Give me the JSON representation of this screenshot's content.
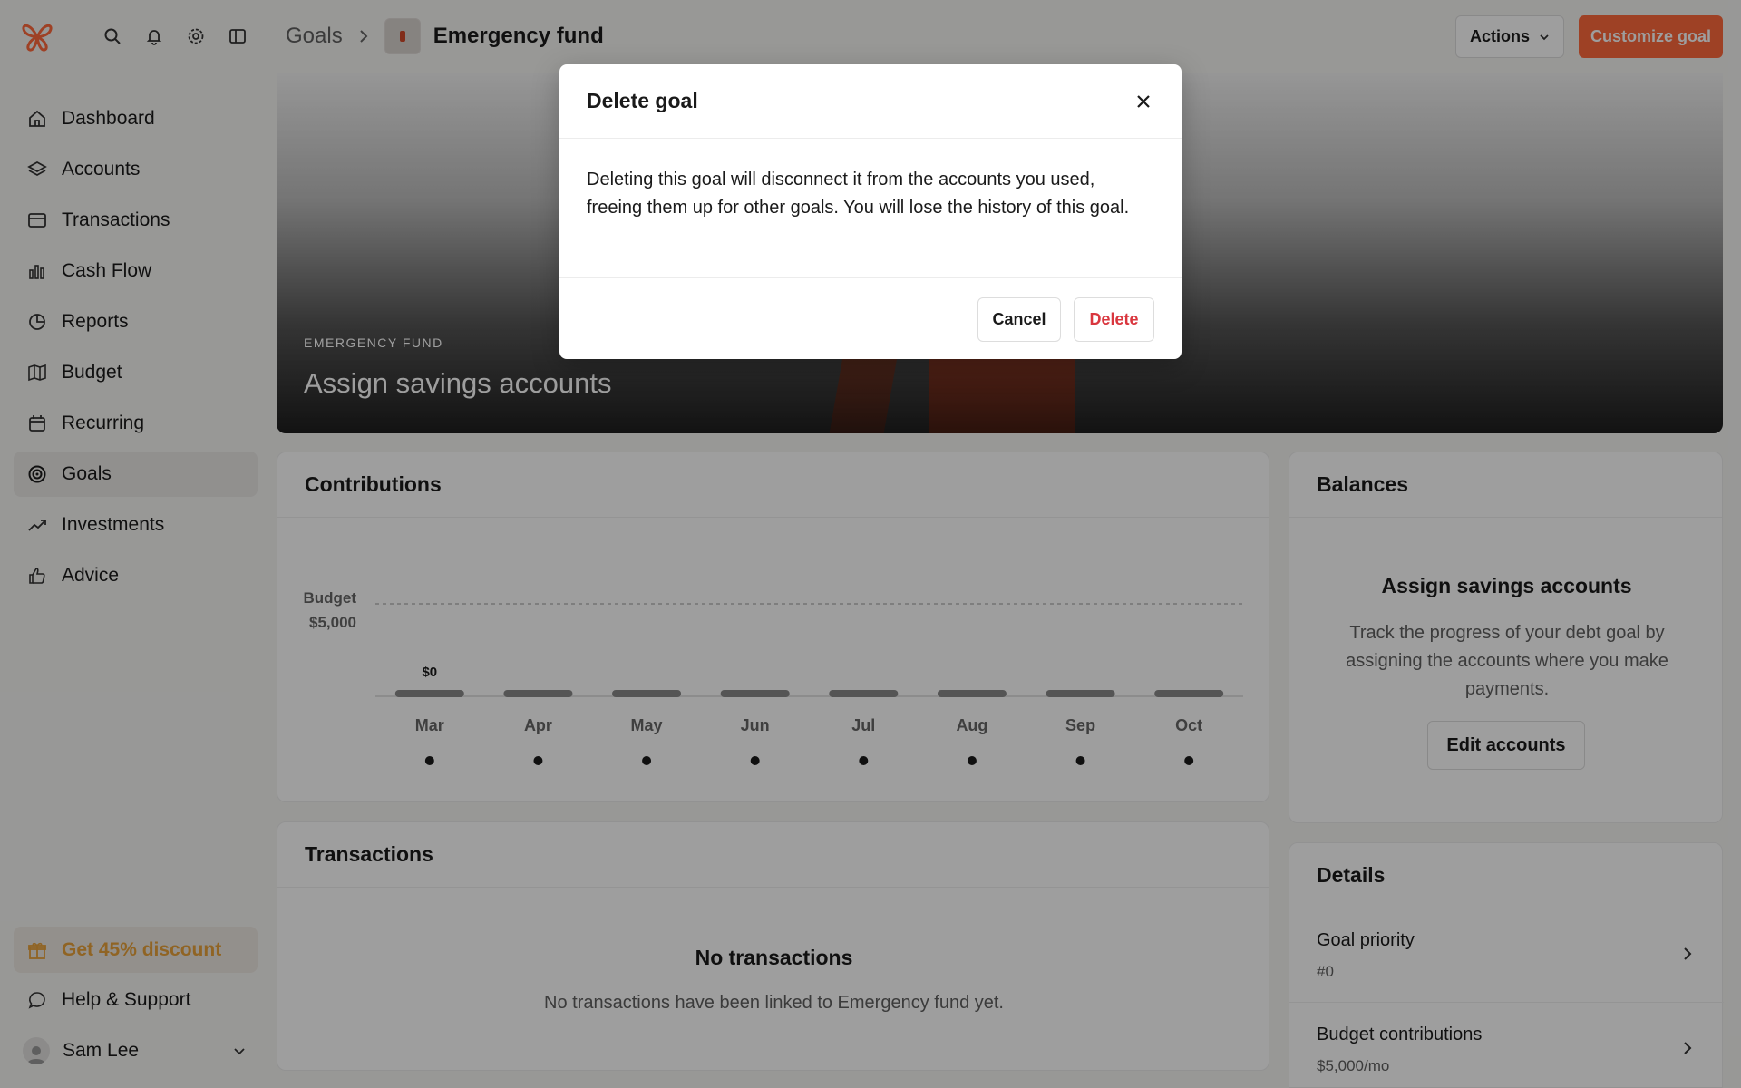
{
  "header": {
    "breadcrumb_root": "Goals",
    "breadcrumb_current": "Emergency fund",
    "actions_label": "Actions",
    "customize_label": "Customize goal"
  },
  "sidebar": {
    "items": [
      {
        "label": "Dashboard",
        "icon": "home-icon"
      },
      {
        "label": "Accounts",
        "icon": "layers-icon"
      },
      {
        "label": "Transactions",
        "icon": "card-icon"
      },
      {
        "label": "Cash Flow",
        "icon": "bar-chart-icon"
      },
      {
        "label": "Reports",
        "icon": "pie-chart-icon"
      },
      {
        "label": "Budget",
        "icon": "map-icon"
      },
      {
        "label": "Recurring",
        "icon": "calendar-icon"
      },
      {
        "label": "Goals",
        "icon": "target-icon"
      },
      {
        "label": "Investments",
        "icon": "trending-up-icon"
      },
      {
        "label": "Advice",
        "icon": "thumbs-up-icon"
      }
    ],
    "active": "Goals",
    "discount_label": "Get 45% discount",
    "help_label": "Help & Support",
    "user_name": "Sam Lee"
  },
  "hero": {
    "eyebrow": "EMERGENCY FUND",
    "title": "Assign savings accounts"
  },
  "contributions": {
    "title": "Contributions"
  },
  "chart_data": {
    "type": "bar",
    "categories": [
      "Mar",
      "Apr",
      "May",
      "Jun",
      "Jul",
      "Aug",
      "Sep",
      "Oct"
    ],
    "values": [
      0,
      0,
      0,
      0,
      0,
      0,
      0,
      0
    ],
    "budget_line_label": "Budget",
    "budget_line_value_label": "$5,000",
    "budget_line_value": 5000,
    "data_labels": [
      "$0",
      "",
      "",
      "",
      "",
      "",
      "",
      ""
    ],
    "ylim": [
      0,
      5000
    ],
    "legend": "none"
  },
  "balances": {
    "title": "Balances",
    "empty_title": "Assign savings accounts",
    "empty_desc": "Track the progress of your debt goal by assigning the accounts where you make payments.",
    "edit_label": "Edit accounts"
  },
  "transactions": {
    "title": "Transactions",
    "empty_title": "No transactions",
    "empty_desc": "No transactions have been linked to Emergency fund yet."
  },
  "details": {
    "title": "Details",
    "rows": [
      {
        "label": "Goal priority",
        "value": "#0"
      },
      {
        "label": "Budget contributions",
        "value": "$5,000/mo"
      }
    ]
  },
  "modal": {
    "title": "Delete goal",
    "body": "Deleting this goal will disconnect it from the accounts you used, freeing them up for other goals. You will lose the history of this goal.",
    "cancel_label": "Cancel",
    "delete_label": "Delete"
  },
  "colors": {
    "brand": "#ff6a3d",
    "danger": "#d9363e",
    "discount": "#e8a23a"
  }
}
